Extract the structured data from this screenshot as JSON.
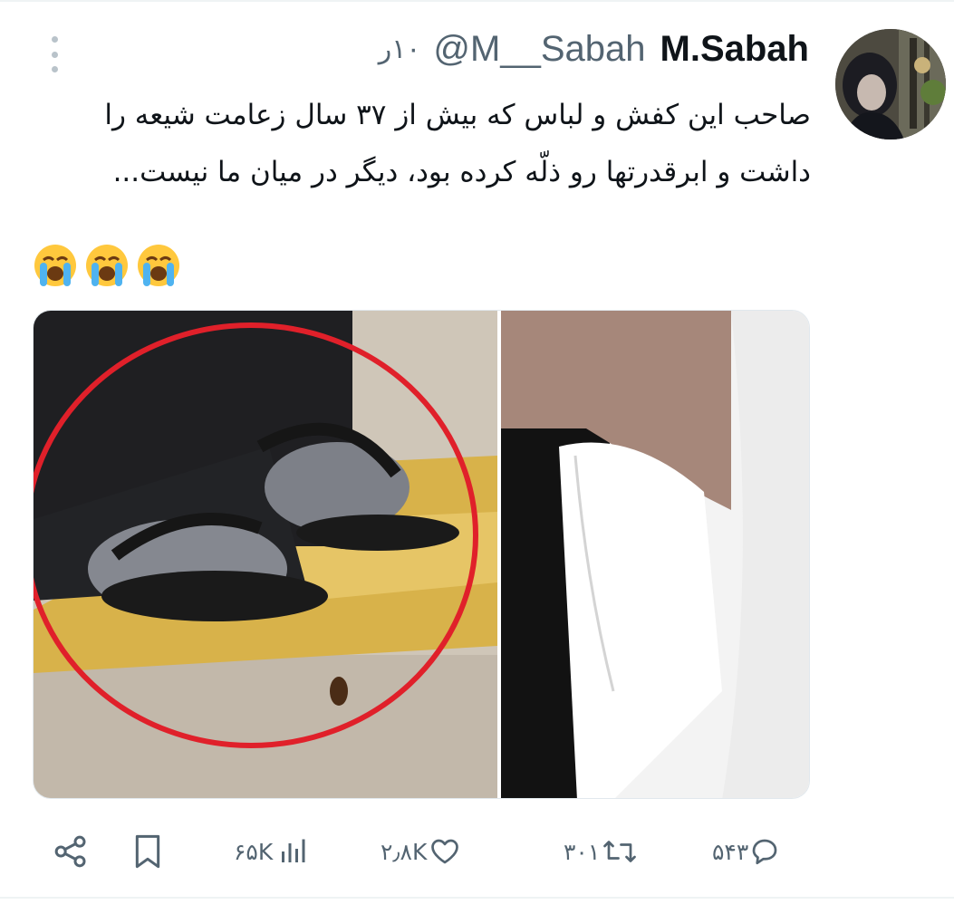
{
  "tweet": {
    "display_name": "M.Sabah",
    "handle": "@M__Sabah",
    "timestamp": "۱۰ر",
    "text": "صاحب این کفش و لباس که بیش از ۳۷ سال زعامت شیعه را داشت و ابرقدرتها رو ذلّه کرده بود، دیگر در میان ما نیست...",
    "emojis": [
      "loudly-crying-face",
      "loudly-crying-face",
      "loudly-crying-face"
    ]
  },
  "stats": {
    "replies": "۵۴۳",
    "retweets": "۳۰۱",
    "likes": "۲٫۸K",
    "views": "۶۵K"
  },
  "icons": {
    "reply": "reply-icon",
    "retweet": "retweet-icon",
    "like": "heart-icon",
    "views": "views-chart-icon",
    "bookmark": "bookmark-icon",
    "share": "share-icon",
    "more": "more-vertical-icon"
  },
  "colors": {
    "text_primary": "#0f1419",
    "text_secondary": "#536471",
    "circle_annotation": "#e0202a"
  }
}
